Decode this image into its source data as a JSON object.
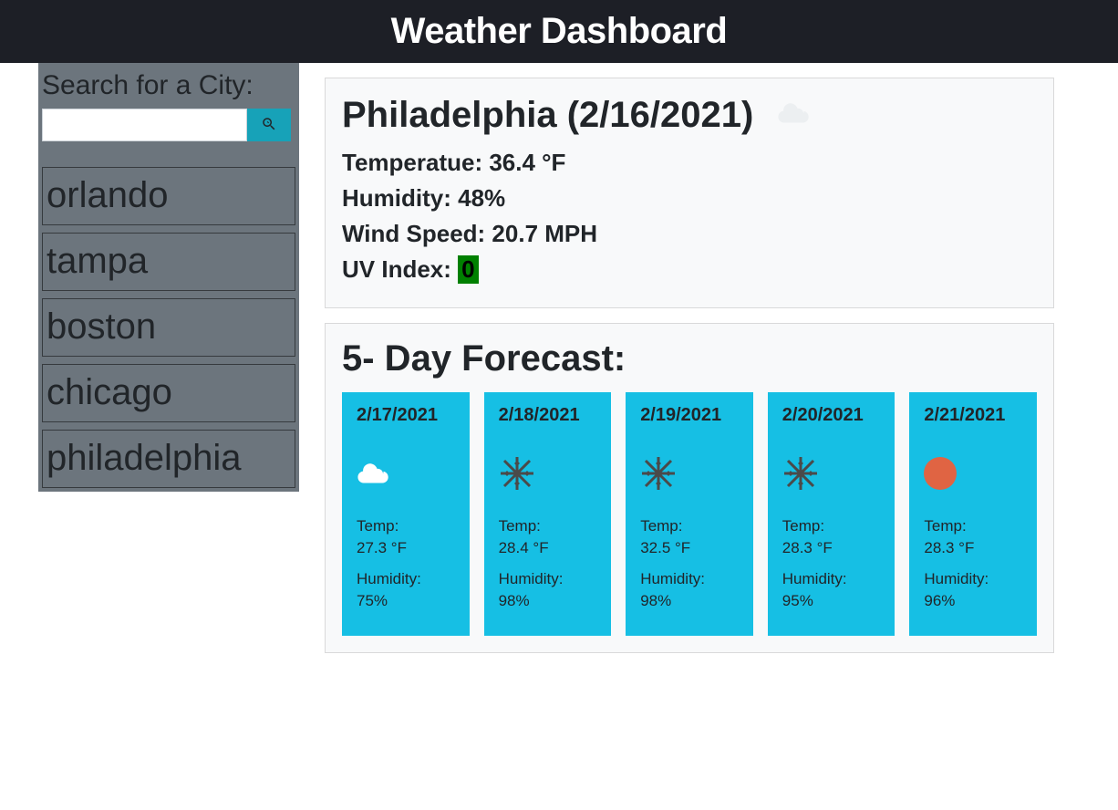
{
  "header": {
    "title": "Weather Dashboard"
  },
  "search": {
    "label": "Search for a City:",
    "value": ""
  },
  "history": [
    "orlando",
    "tampa",
    "boston",
    "chicago",
    "philadelphia"
  ],
  "today": {
    "title": "Philadelphia (2/16/2021)",
    "icon": "cloud",
    "temp_label": "Temperatue: 36.4 °F",
    "humidity_label": "Humidity: 48%",
    "wind_label": "Wind Speed: 20.7 MPH",
    "uv_prefix": "UV Index: ",
    "uv_value": "0",
    "uv_color": "#008000"
  },
  "forecast": {
    "title": "5- Day Forecast:",
    "days": [
      {
        "date": "2/17/2021",
        "icon": "cloud",
        "temp_label": "Temp:",
        "temp": "27.3 °F",
        "hum_label": "Humidity:",
        "hum": "75%"
      },
      {
        "date": "2/18/2021",
        "icon": "snowflake",
        "temp_label": "Temp:",
        "temp": "28.4 °F",
        "hum_label": "Humidity:",
        "hum": "98%"
      },
      {
        "date": "2/19/2021",
        "icon": "snowflake",
        "temp_label": "Temp:",
        "temp": "32.5 °F",
        "hum_label": "Humidity:",
        "hum": "98%"
      },
      {
        "date": "2/20/2021",
        "icon": "snowflake",
        "temp_label": "Temp:",
        "temp": "28.3 °F",
        "hum_label": "Humidity:",
        "hum": "95%"
      },
      {
        "date": "2/21/2021",
        "icon": "sun",
        "temp_label": "Temp:",
        "temp": "28.3 °F",
        "hum_label": "Humidity:",
        "hum": "96%"
      }
    ]
  }
}
